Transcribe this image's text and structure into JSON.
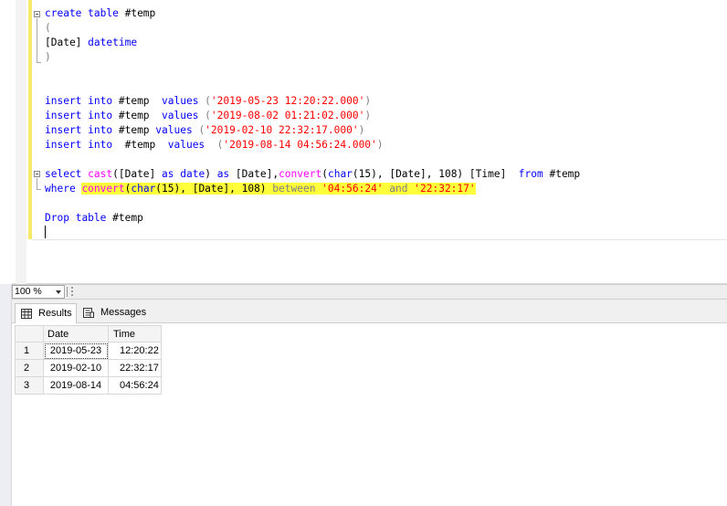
{
  "editor": {
    "lines": {
      "l1": {
        "kw1": "create",
        "kw2": "table",
        "rest": " #temp"
      },
      "l2": {
        "text": "("
      },
      "l3": {
        "col": "[Date]",
        "type": "datetime"
      },
      "l4": {
        "text": ")"
      },
      "ins1": {
        "k1": "insert",
        "k2": "into",
        "tbl": " #temp  ",
        "k3": "values",
        "p1": " (",
        "s": "'2019-05-23 12:20:22.000'",
        "p2": ")"
      },
      "ins2": {
        "k1": "insert",
        "k2": "into",
        "tbl": " #temp  ",
        "k3": "values",
        "p1": " (",
        "s": "'2019-08-02 01:21:02.000'",
        "p2": ")"
      },
      "ins3": {
        "k1": "insert",
        "k2": "into",
        "tbl": " #temp ",
        "k3": "values",
        "p1": " (",
        "s": "'2019-02-10 22:32:17.000'",
        "p2": ")"
      },
      "ins4": {
        "k1": "insert",
        "k2": "into",
        "tbl": "  #temp  ",
        "k3": "values",
        "p1": "  (",
        "s": "'2019-08-14 04:56:24.000'",
        "p2": ")"
      },
      "sel": {
        "k1": "select",
        "f1": "cast",
        "a": "([Date] ",
        "k2": "as",
        "b": " ",
        "k3": "date",
        "c": ") ",
        "k4": "as",
        "d": " [Date],",
        "f2": "convert",
        "e": "(",
        "k5": "char",
        "g": "(15), [Date], 108) [Time]  ",
        "k6": "from",
        "h": " #temp"
      },
      "where": {
        "k1": "where",
        "f1": "convert",
        "a": "(",
        "k2": "char",
        "b": "(15), [Date], 108) ",
        "k3": "between",
        "c": " ",
        "s1": "'04:56:24'",
        "d": " ",
        "k4": "and",
        "e": " ",
        "s2": "'22:32:17'"
      },
      "drop": {
        "k1": "Drop",
        "k2": "table",
        "rest": " #temp"
      }
    }
  },
  "zoom": {
    "value": "100 %"
  },
  "tabs": {
    "results": "Results",
    "messages": "Messages"
  },
  "grid": {
    "columns": [
      "Date",
      "Time"
    ],
    "rows": [
      {
        "num": "1",
        "date": "2019-05-23",
        "time": "12:20:22"
      },
      {
        "num": "2",
        "date": "2019-02-10",
        "time": "22:32:17"
      },
      {
        "num": "3",
        "date": "2019-08-14",
        "time": "04:56:24"
      }
    ]
  },
  "colors": {
    "keyword": "#0000ff",
    "function": "#ff00ff",
    "string": "#ff0000",
    "operator": "#808080",
    "highlight": "#ffff3a",
    "change_bar": "#f7e96a"
  }
}
